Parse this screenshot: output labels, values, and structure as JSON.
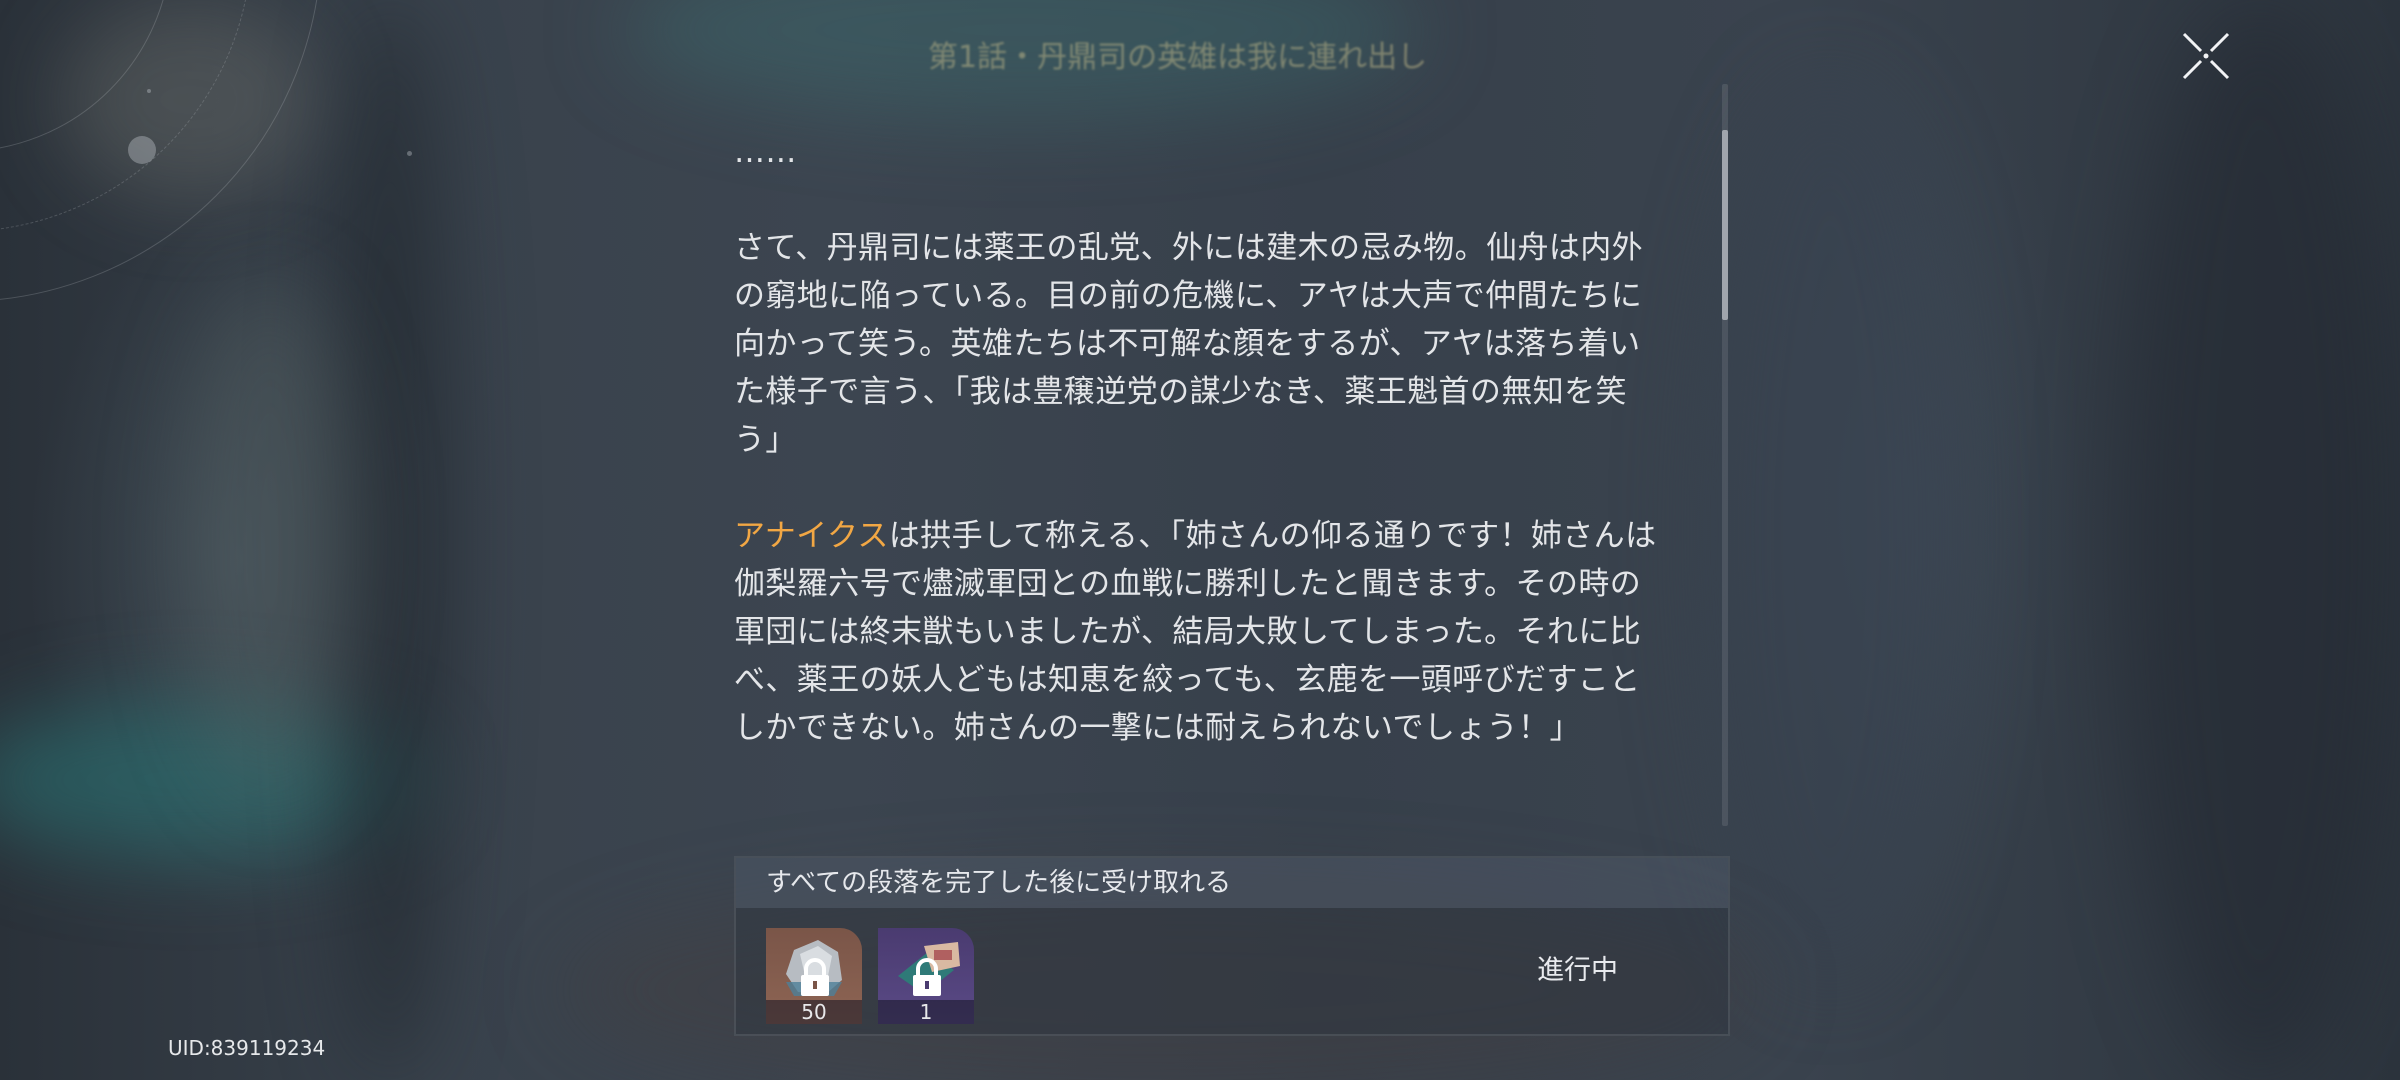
{
  "header": {
    "chapter_title": "第1話・丹鼎司の英雄は我に連れ出し"
  },
  "article": {
    "paragraphs": [
      {
        "segments": [
          {
            "text": "……",
            "highlight": false
          }
        ]
      },
      {
        "segments": [
          {
            "text": "さて、丹鼎司には薬王の乱党、外には建木の忌み物。仙舟は内外の窮地に陥っている。目の前の危機に、アヤは大声で仲間たちに向かって笑う。英雄たちは不可解な顔をするが、アヤは落ち着いた様子で言う、「我は豊穣逆党の謀少なき、薬王魁首の無知を笑う」",
            "highlight": false
          }
        ]
      },
      {
        "segments": [
          {
            "text": "アナイクス",
            "highlight": true
          },
          {
            "text": "は拱手して称える、「姉さんの仰る通りです！姉さんは伽梨羅六号で燼滅軍団との血戦に勝利したと聞きます。その時の軍団には終末獣もいましたが、結局大敗してしまった。それに比べ、薬王の妖人どもは知恵を絞っても、玄鹿を一頭呼びだすことしかできない。姉さんの一撃には耐えられないでしょう！」",
            "highlight": false
          }
        ]
      }
    ]
  },
  "reward": {
    "header": "すべての段落を完了した後に受け取れる",
    "items": [
      {
        "icon": "stone-material-icon",
        "count": "50",
        "rarity": "orange",
        "locked": true
      },
      {
        "icon": "card-item-icon",
        "count": "1",
        "rarity": "purple",
        "locked": true
      }
    ],
    "status": "進行中"
  },
  "footer": {
    "uid": "UID:839119234"
  },
  "icons": {
    "close": "close-icon",
    "lock": "lock-icon"
  },
  "colors": {
    "highlight": "#f2a744",
    "text": "#e3e5e8"
  }
}
